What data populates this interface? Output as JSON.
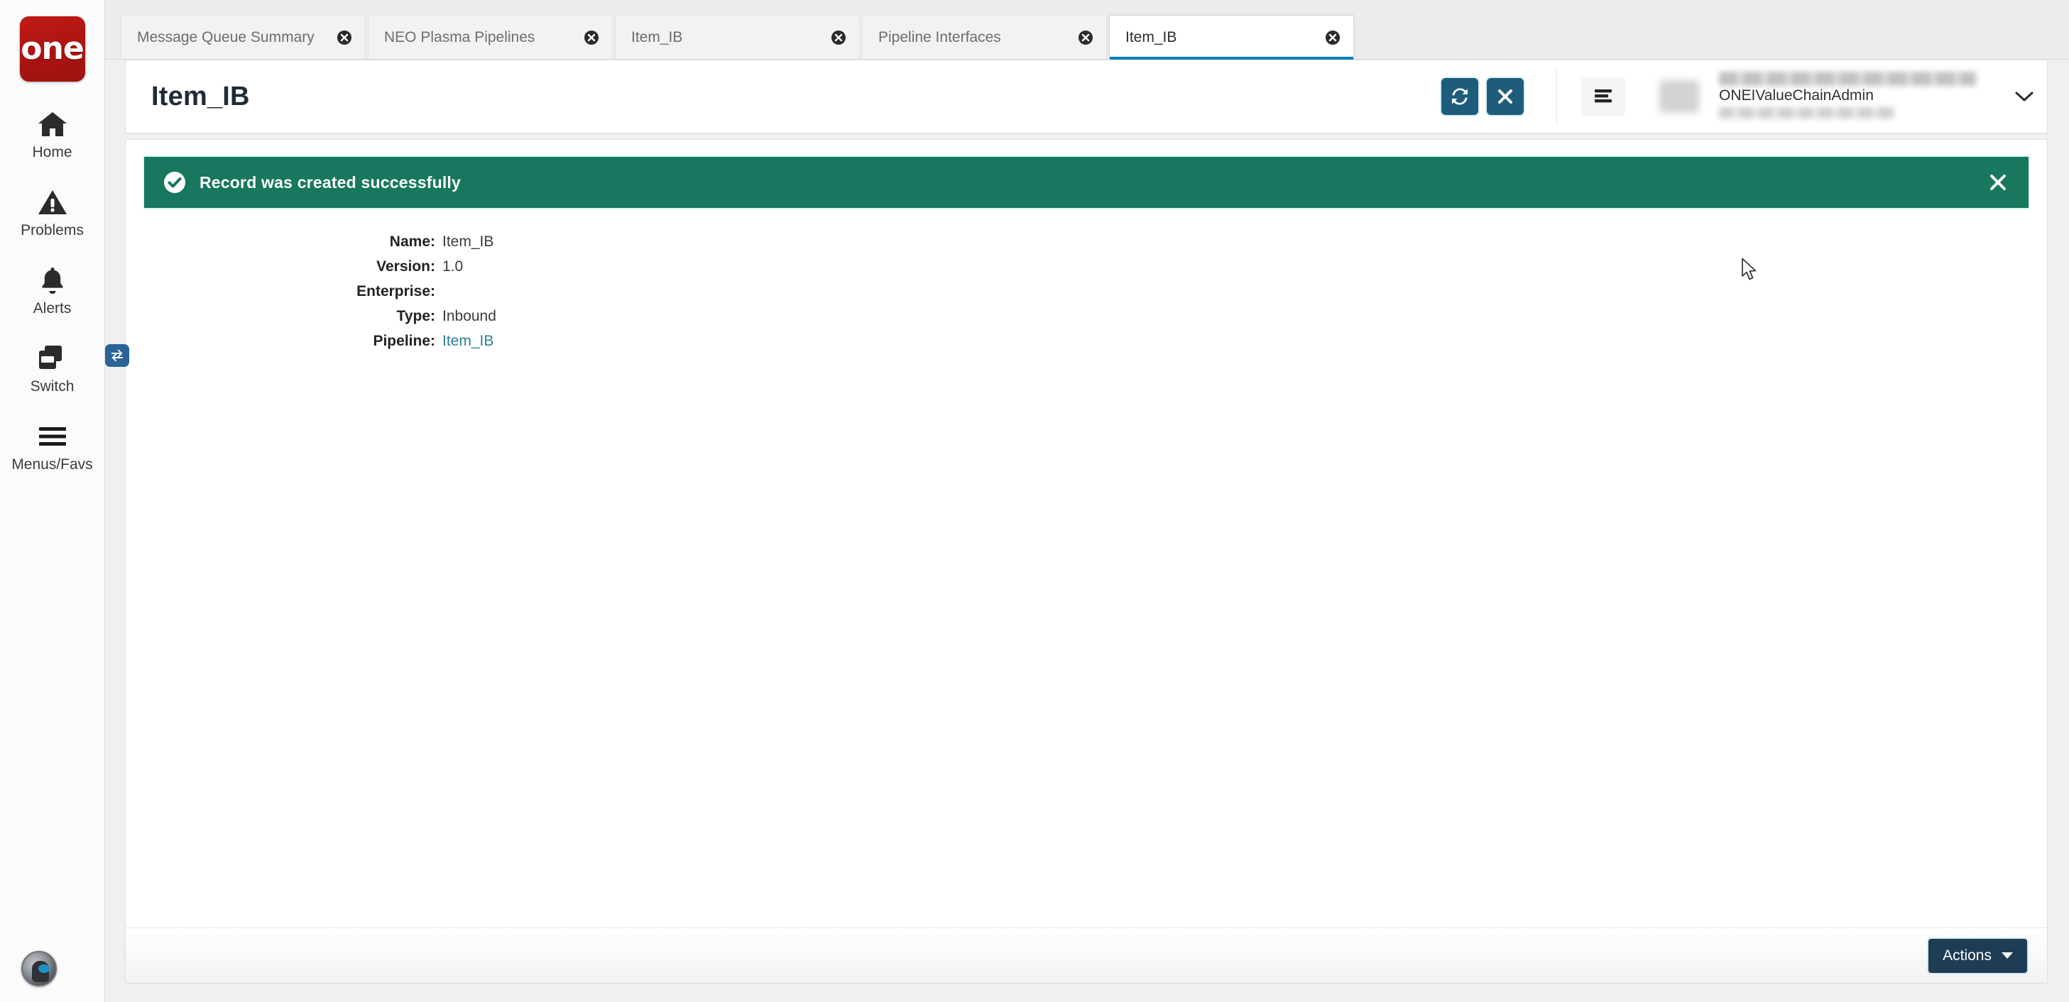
{
  "brand": {
    "logo_text": "one"
  },
  "sidebar": {
    "items": [
      {
        "label": "Home",
        "icon": "home-icon"
      },
      {
        "label": "Problems",
        "icon": "warning-triangle-icon"
      },
      {
        "label": "Alerts",
        "icon": "bell-icon"
      },
      {
        "label": "Switch",
        "icon": "windows-stack-icon",
        "badge_icon": "swap-arrows-icon"
      },
      {
        "label": "Menus/Favs",
        "icon": "hamburger-icon"
      }
    ],
    "assistant": {
      "icon": "ai-assistant-orb-icon"
    }
  },
  "tabs": [
    {
      "label": "Message Queue Summary",
      "active": false
    },
    {
      "label": "NEO Plasma Pipelines",
      "active": false
    },
    {
      "label": "Item_IB",
      "active": false
    },
    {
      "label": "Pipeline Interfaces",
      "active": false
    },
    {
      "label": "Item_IB",
      "active": true
    }
  ],
  "header": {
    "title": "Item_IB",
    "refresh_icon": "refresh-icon",
    "close_icon": "close-x-icon",
    "menu_icon": "hamburger-menu-icon",
    "user_name": "ONEIValueChainAdmin",
    "caret_icon": "chevron-down-icon"
  },
  "banner": {
    "icon": "check-circle-icon",
    "message": "Record was created successfully",
    "close_icon": "close-x-icon",
    "color": "#17775f"
  },
  "details": [
    {
      "label": "Name:",
      "value": "Item_IB",
      "link": false
    },
    {
      "label": "Version:",
      "value": "1.0",
      "link": false
    },
    {
      "label": "Enterprise:",
      "value": "",
      "link": false
    },
    {
      "label": "Type:",
      "value": "Inbound",
      "link": false
    },
    {
      "label": "Pipeline:",
      "value": "Item_IB",
      "link": true
    }
  ],
  "footer": {
    "actions_label": "Actions",
    "actions_caret_icon": "caret-down-icon"
  },
  "colors": {
    "brand_red": "#b0150f",
    "accent_button": "#1d5d7b",
    "success_green": "#17775f",
    "link_teal": "#2f7d95",
    "active_tab_underline": "#0f7fbd",
    "actions_navy": "#1f3c55"
  }
}
